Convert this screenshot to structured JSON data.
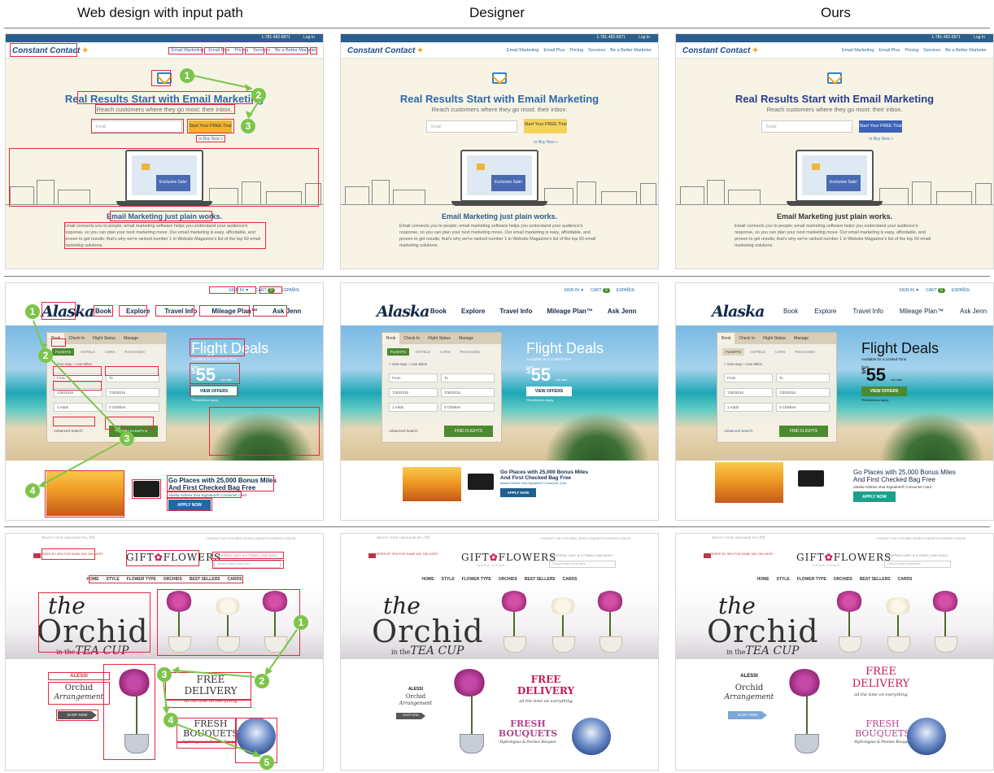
{
  "headers": [
    "Web design with input path",
    "Designer",
    "Ours"
  ],
  "constant_contact": {
    "logo": "Constant Contact",
    "phone": "1-781-482-8971",
    "login": "Log In",
    "menu": [
      "Email Marketing",
      "Email Plus",
      "Pricing",
      "Services",
      "Be a Better Marketer"
    ],
    "headline": "Real Results Start with Email Marketing",
    "subhead": "Reach customers where they go most: their inbox.",
    "email_placeholder": "Email",
    "cta_input_path": "Start Your FREE Trial",
    "cta_designer": "Start Your FREE Trial",
    "cta_ours": "Start Your FREE Trial",
    "buy": "or Buy Now »",
    "laptop_sale": "Exclusive Sale!",
    "section_title": "Email Marketing just plain works.",
    "body": "Email connects you to people; email marketing software helps you understand your audience's response, so you can plan your next marketing move. Our email marketing is easy, affordable, and proven to get results; that's why we're ranked number 1 in Website Magazine's list of the top 50 email marketing solutions.",
    "colors": {
      "cta_input_path": "#f0b230",
      "cta_designer": "#f5d35b",
      "cta_ours": "#3d63b8"
    }
  },
  "alaska": {
    "logo": "Alaska",
    "signin": "SIGN IN ▼",
    "cart": "CART",
    "cart_count": "0",
    "lang": "ESPAÑOL",
    "nav": [
      "Book",
      "Explore",
      "Travel Info",
      "Mileage Plan™",
      "Ask Jenn"
    ],
    "tabs": [
      "Book",
      "Check In",
      "Flight Status",
      "Manage"
    ],
    "subtabs": [
      "FLIGHTS",
      "HOTELS",
      "CARS",
      "PACKAGES"
    ],
    "radio": "○ One-way   ○ Use Miles",
    "from": "From",
    "to": "To",
    "date1": "7/30/2015",
    "date2": "7/30/2015",
    "adults": "1 Adult",
    "children": "0 Children",
    "advanced": "Advanced Search",
    "find": "FIND FLIGHTS",
    "deal_title": "Flight Deals",
    "deal_sub": "Available for a Limited Time",
    "from_label": "From",
    "price": "55",
    "price_symbol": "$",
    "price_note": "one way*",
    "view": "VIEW OFFERS",
    "restrictions": "*Restrictions Apply",
    "promo_headline_1": "Go Places with 25,000 Bonus Miles",
    "promo_headline_2": "And First Checked Bag Free",
    "promo_card": "Alaska Airlines Visa Signature® Consumer Card",
    "apply": "APPLY NOW",
    "colors": {
      "apply_input_path": "#1f6aa1",
      "apply_designer": "#1f5f8f",
      "apply_ours": "#1e9e8c"
    }
  },
  "gift_flowers": {
    "top_left": "SELECT YOUR LANGUAGE  EN  |  中文",
    "top_right": "CONTACT US  2723 3303  |  ✉ HELLO@GIFTFLOWERS.COM.HK",
    "banner": "ORDER BY 3PM FOR SAME DAY DELIVERY",
    "logo_a": "GIFT",
    "logo_b": "FLOWERS",
    "logo_sub": "HONG KONG",
    "cart": "SHOPPING CART ▼ 0 ITEMS  |  CHECKOUT",
    "search": "Search entire store here",
    "nav": [
      "HOME",
      "STYLE",
      "FLOWER TYPE",
      "ORCHIDS",
      "BEST SELLERS",
      "CARDS"
    ],
    "the": "the",
    "orchid": "Orchid",
    "in_the": "in the",
    "tea_cup": "TEA CUP",
    "alessi": "ALESSI",
    "orchid2": "Orchid",
    "arrangement": "Arrangement",
    "shop": "SHOP NOW",
    "free": "FREE",
    "delivery": "DELIVERY",
    "all_time": "all the time on everything",
    "fresh": "FRESH",
    "bouquets": "BOUQUETS",
    "hydrangeas": "- Hydrangeas & Peonies Bouquet -",
    "colors": {
      "free_input_path": "#333333",
      "free_designer": "#c51a5b",
      "free_ours": "#c51a5b",
      "shop_designer": "#555555",
      "shop_ours": "#7ba6d8"
    }
  },
  "path_numbers": {
    "cc": [
      "1",
      "2",
      "3"
    ],
    "ak": [
      "1",
      "2",
      "3",
      "4"
    ],
    "gf": [
      "1",
      "2",
      "3",
      "4",
      "5"
    ]
  }
}
